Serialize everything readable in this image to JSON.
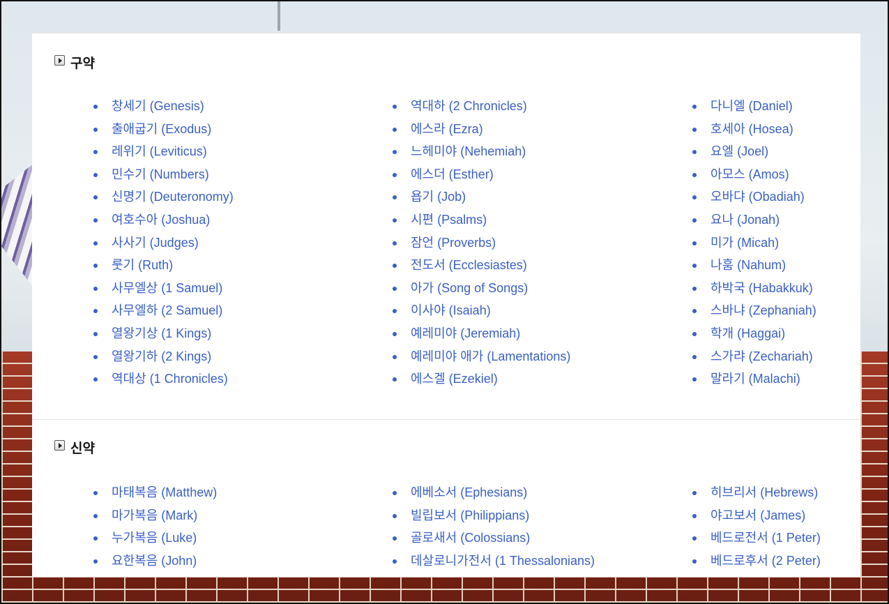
{
  "sections": {
    "old_testament": {
      "title": "구약",
      "columns": [
        [
          "창세기 (Genesis)",
          "출애굽기 (Exodus)",
          "레위기 (Leviticus)",
          "민수기 (Numbers)",
          "신명기 (Deuteronomy)",
          "여호수아 (Joshua)",
          "사사기 (Judges)",
          "룻기 (Ruth)",
          "사무엘상 (1 Samuel)",
          "사무엘하 (2 Samuel)",
          "열왕기상 (1 Kings)",
          "열왕기하 (2 Kings)",
          "역대상 (1 Chronicles)"
        ],
        [
          "역대하 (2 Chronicles)",
          "에스라 (Ezra)",
          "느헤미야 (Nehemiah)",
          "에스더 (Esther)",
          "욥기 (Job)",
          "시편 (Psalms)",
          "잠언 (Proverbs)",
          "전도서 (Ecclesiastes)",
          "아가 (Song of Songs)",
          "이사야 (Isaiah)",
          "예레미야 (Jeremiah)",
          "예레미야 애가 (Lamentations)",
          "에스겔 (Ezekiel)"
        ],
        [
          "다니엘 (Daniel)",
          "호세아 (Hosea)",
          "요엘 (Joel)",
          "아모스 (Amos)",
          "오바댜 (Obadiah)",
          "요나 (Jonah)",
          "미가 (Micah)",
          "나훔 (Nahum)",
          "하박국 (Habakkuk)",
          "스바냐 (Zephaniah)",
          "학개 (Haggai)",
          "스가랴 (Zechariah)",
          "말라기 (Malachi)"
        ]
      ]
    },
    "new_testament": {
      "title": "신약",
      "columns": [
        [
          "마태복음 (Matthew)",
          "마가복음 (Mark)",
          "누가복음 (Luke)",
          "요한복음 (John)"
        ],
        [
          "에베소서 (Ephesians)",
          "빌립보서 (Philippians)",
          "골로새서 (Colossians)",
          "데살로니가전서 (1 Thessalonians)"
        ],
        [
          "히브리서 (Hebrews)",
          "야고보서 (James)",
          "베드로전서 (1 Peter)",
          "베드로후서 (2 Peter)"
        ]
      ]
    }
  },
  "colors": {
    "link": "#3a60c6",
    "bullet": "#3a5ec8",
    "title": "#111111"
  },
  "icons": {
    "section_toggle": "collapse-toggle-icon"
  }
}
